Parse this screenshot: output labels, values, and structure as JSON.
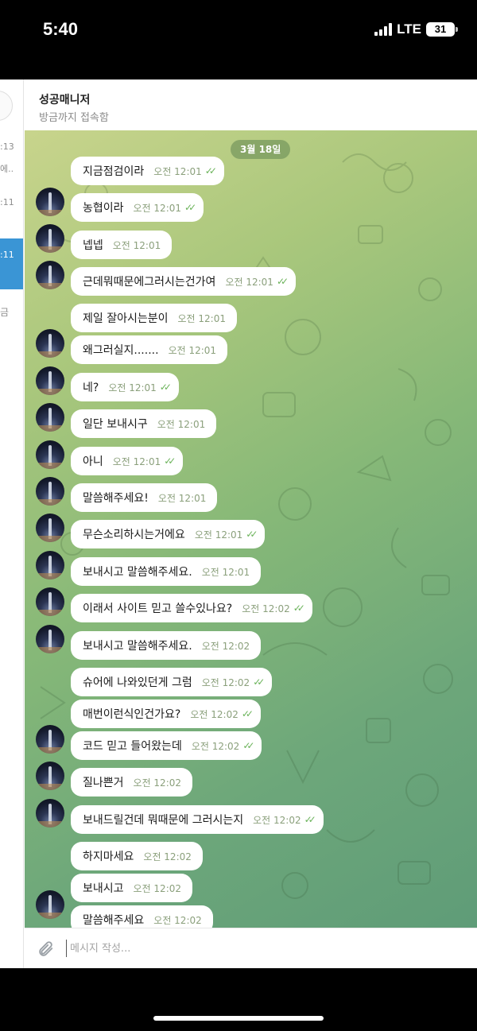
{
  "status_bar": {
    "time": "5:40",
    "network": "LTE",
    "battery": "31"
  },
  "left_panel": {
    "times": [
      ":13",
      "에..",
      ":11",
      ":11",
      "금"
    ]
  },
  "header": {
    "title": "성공매니저",
    "subtitle": "방금까지 접속함"
  },
  "date_pill": "3월 18일",
  "messages": [
    {
      "text": "지금점검이라",
      "time": "오전 12:01",
      "ticks": "✓✓"
    },
    {
      "text": "농협이라",
      "time": "오전 12:01",
      "ticks": "✓✓"
    },
    {
      "text": "넵넵",
      "time": "오전 12:01",
      "ticks": ""
    },
    {
      "text": "근데뭐때문에그러시는건가여",
      "time": "오전 12:01",
      "ticks": "✓✓"
    },
    {
      "text": "제일 잘아시는분이",
      "time": "오전 12:01",
      "ticks": ""
    },
    {
      "text": "왜그러실지.......",
      "time": "오전 12:01",
      "ticks": ""
    },
    {
      "text": "네?",
      "time": "오전 12:01",
      "ticks": "✓✓"
    },
    {
      "text": "일단 보내시구",
      "time": "오전 12:01",
      "ticks": ""
    },
    {
      "text": "아니",
      "time": "오전 12:01",
      "ticks": "✓✓"
    },
    {
      "text": "말씀해주세요!",
      "time": "오전 12:01",
      "ticks": ""
    },
    {
      "text": "무슨소리하시는거에요",
      "time": "오전 12:01",
      "ticks": "✓✓"
    },
    {
      "text": "보내시고 말씀해주세요.",
      "time": "오전 12:01",
      "ticks": ""
    },
    {
      "text": "이래서 사이트 믿고 쓸수있나요?",
      "time": "오전 12:02",
      "ticks": "✓✓"
    },
    {
      "text": "보내시고 말씀해주세요.",
      "time": "오전 12:02",
      "ticks": ""
    },
    {
      "text": "슈어에 나와있던게 그럼",
      "time": "오전 12:02",
      "ticks": "✓✓"
    },
    {
      "text": "매번이런식인건가요?",
      "time": "오전 12:02",
      "ticks": "✓✓"
    },
    {
      "text": "코드 믿고 들어왔는데",
      "time": "오전 12:02",
      "ticks": "✓✓"
    },
    {
      "text": "질나쁜거",
      "time": "오전 12:02",
      "ticks": ""
    },
    {
      "text": "보내드릴건데 뭐때문에 그러시는지",
      "time": "오전 12:02",
      "ticks": "✓✓"
    },
    {
      "text": "하지마세요",
      "time": "오전 12:02",
      "ticks": ""
    },
    {
      "text": "보내시고",
      "time": "오전 12:02",
      "ticks": ""
    },
    {
      "text": "말씀해주세요",
      "time": "오전 12:02",
      "ticks": ""
    }
  ],
  "composer": {
    "placeholder": "메시지 작성..."
  }
}
